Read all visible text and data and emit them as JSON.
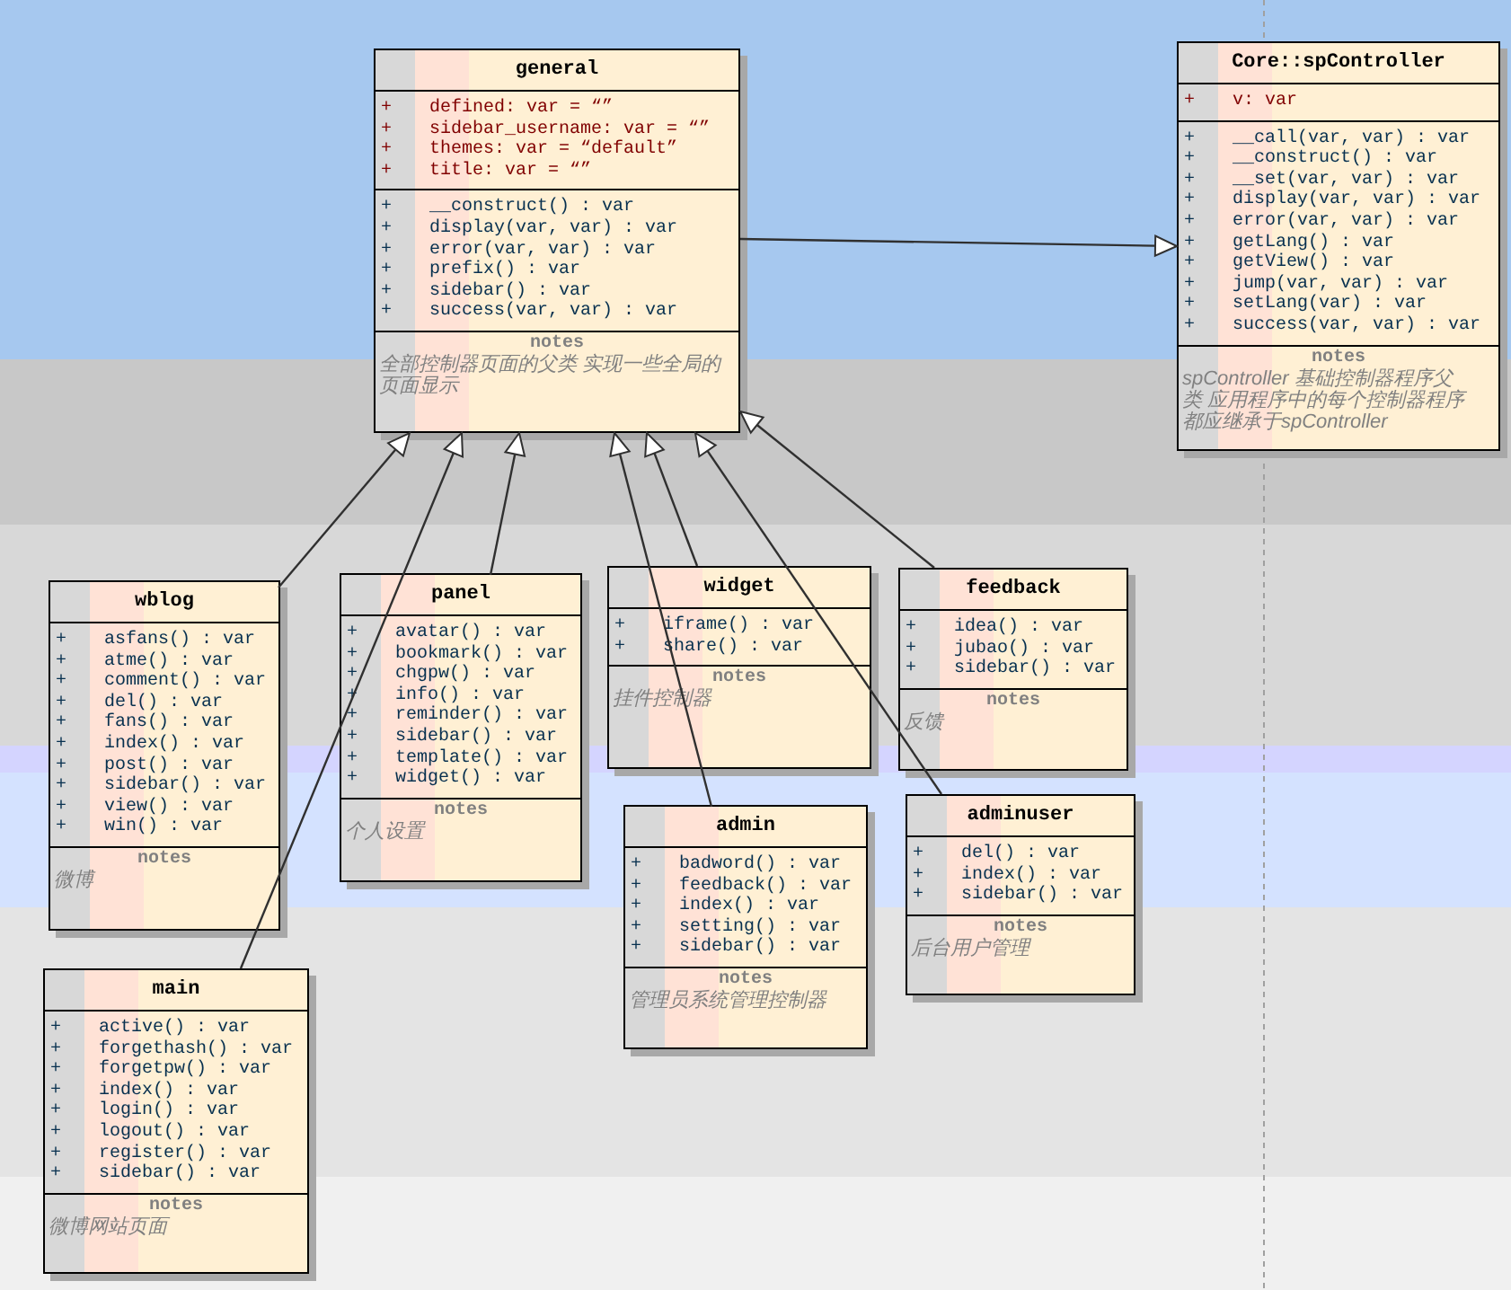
{
  "classes": [
    {
      "name": "general",
      "extends_parent": true,
      "attributes": [
        {
          "visibility": "+",
          "text": "defined:  var = “”"
        },
        {
          "visibility": "+",
          "text": "sidebar_username:  var = “”"
        },
        {
          "visibility": "+",
          "text": "themes:  var = “default”"
        },
        {
          "visibility": "+",
          "text": "title:  var = “”"
        }
      ],
      "operations": [
        {
          "visibility": "+",
          "text": "__construct() : var"
        },
        {
          "visibility": "+",
          "text": "display(var, var) : var"
        },
        {
          "visibility": "+",
          "text": "error(var, var) : var"
        },
        {
          "visibility": "+",
          "text": "prefix() : var"
        },
        {
          "visibility": "+",
          "text": "sidebar() : var"
        },
        {
          "visibility": "+",
          "text": "success(var, var) : var"
        }
      ],
      "notes_label": "notes",
      "notes": "全部控制器页面的父类  实现一些全局的页面显示"
    },
    {
      "name": "Core::spController",
      "extends_parent": false,
      "attributes": [
        {
          "visibility": "+",
          "text": "v:  var"
        }
      ],
      "operations": [
        {
          "visibility": "+",
          "text": "__call(var, var) : var"
        },
        {
          "visibility": "+",
          "text": "__construct() : var"
        },
        {
          "visibility": "+",
          "text": "__set(var, var) : var"
        },
        {
          "visibility": "+",
          "text": "display(var, var) : var"
        },
        {
          "visibility": "+",
          "text": "error(var, var) : var"
        },
        {
          "visibility": "+",
          "text": "getLang() : var"
        },
        {
          "visibility": "+",
          "text": "getView() : var"
        },
        {
          "visibility": "+",
          "text": "jump(var, var) : var"
        },
        {
          "visibility": "+",
          "text": "setLang(var) : var"
        },
        {
          "visibility": "+",
          "text": "success(var, var) : var"
        }
      ],
      "notes_label": "notes",
      "notes": "spController 基础控制器程序父类 应用程序中的每个控制器程序都应继承于spController"
    },
    {
      "name": "wblog",
      "extends_parent": true,
      "operations": [
        {
          "visibility": "+",
          "text": "asfans() : var"
        },
        {
          "visibility": "+",
          "text": "atme() : var"
        },
        {
          "visibility": "+",
          "text": "comment() : var"
        },
        {
          "visibility": "+",
          "text": "del() : var"
        },
        {
          "visibility": "+",
          "text": "fans() : var"
        },
        {
          "visibility": "+",
          "text": "index() : var"
        },
        {
          "visibility": "+",
          "text": "post() : var"
        },
        {
          "visibility": "+",
          "text": "sidebar() : var"
        },
        {
          "visibility": "+",
          "text": "view() : var"
        },
        {
          "visibility": "+",
          "text": "win() : var"
        }
      ],
      "notes_label": "notes",
      "notes": "微博"
    },
    {
      "name": "panel",
      "extends_parent": true,
      "operations": [
        {
          "visibility": "+",
          "text": "avatar() : var"
        },
        {
          "visibility": "+",
          "text": "bookmark() : var"
        },
        {
          "visibility": "+",
          "text": "chgpw() : var"
        },
        {
          "visibility": "+",
          "text": "info() : var"
        },
        {
          "visibility": "+",
          "text": "reminder() : var"
        },
        {
          "visibility": "+",
          "text": "sidebar() : var"
        },
        {
          "visibility": "+",
          "text": "template() : var"
        },
        {
          "visibility": "+",
          "text": "widget() : var"
        }
      ],
      "notes_label": "notes",
      "notes": "个人设置"
    },
    {
      "name": "widget",
      "extends_parent": true,
      "operations": [
        {
          "visibility": "+",
          "text": "iframe() : var"
        },
        {
          "visibility": "+",
          "text": "share() : var"
        }
      ],
      "notes_label": "notes",
      "notes": "挂件控制器"
    },
    {
      "name": "feedback",
      "extends_parent": true,
      "operations": [
        {
          "visibility": "+",
          "text": "idea() : var"
        },
        {
          "visibility": "+",
          "text": "jubao() : var"
        },
        {
          "visibility": "+",
          "text": "sidebar() : var"
        }
      ],
      "notes_label": "notes",
      "notes": "反馈"
    },
    {
      "name": "admin",
      "extends_parent": true,
      "operations": [
        {
          "visibility": "+",
          "text": "badword() : var"
        },
        {
          "visibility": "+",
          "text": "feedback() : var"
        },
        {
          "visibility": "+",
          "text": "index() : var"
        },
        {
          "visibility": "+",
          "text": "setting() : var"
        },
        {
          "visibility": "+",
          "text": "sidebar() : var"
        }
      ],
      "notes_label": "notes",
      "notes": "管理员系统管理控制器"
    },
    {
      "name": "adminuser",
      "extends_parent": true,
      "operations": [
        {
          "visibility": "+",
          "text": "del() : var"
        },
        {
          "visibility": "+",
          "text": "index() : var"
        },
        {
          "visibility": "+",
          "text": "sidebar() : var"
        }
      ],
      "notes_label": "notes",
      "notes": "后台用户管理"
    },
    {
      "name": "main",
      "extends_parent": true,
      "operations": [
        {
          "visibility": "+",
          "text": "active() : var"
        },
        {
          "visibility": "+",
          "text": "forgethash() : var"
        },
        {
          "visibility": "+",
          "text": "forgetpw() : var"
        },
        {
          "visibility": "+",
          "text": "index() : var"
        },
        {
          "visibility": "+",
          "text": "login() : var"
        },
        {
          "visibility": "+",
          "text": "logout() : var"
        },
        {
          "visibility": "+",
          "text": "register() : var"
        },
        {
          "visibility": "+",
          "text": "sidebar() : var"
        }
      ],
      "notes_label": "notes",
      "notes": "微博网站页面"
    }
  ]
}
